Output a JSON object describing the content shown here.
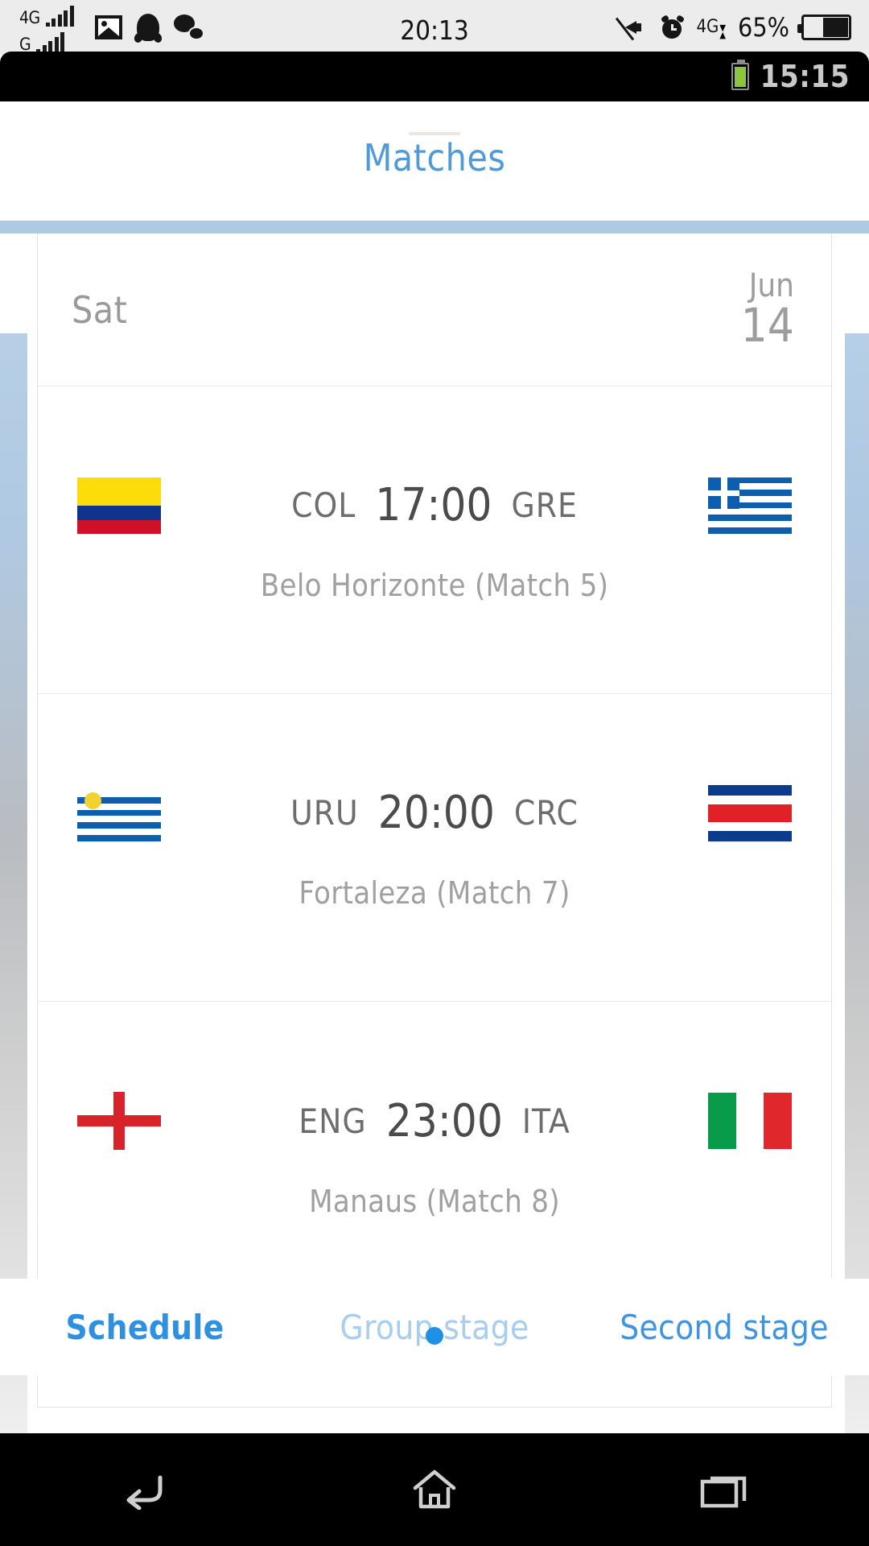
{
  "system_status_bar": {
    "sim1": {
      "network": "4G",
      "signal_bars": 5
    },
    "sim2": {
      "network": "G",
      "signal_bars": 5
    },
    "notification_icons": [
      "photo-icon",
      "qq-icon",
      "wechat-icon"
    ],
    "clock": "20:13",
    "right_icons": [
      "mute-icon",
      "alarm-icon",
      "mobile-data-4g-icon"
    ],
    "battery_percent": "65%",
    "data_network": "4G"
  },
  "inner_status_bar": {
    "battery": "battery-icon",
    "battery_color": "#8cc63f",
    "clock": "15:15"
  },
  "header": {
    "title": "Matches"
  },
  "schedule": {
    "date": {
      "weekday": "Sat",
      "month": "Jun",
      "day": "14"
    },
    "matches": [
      {
        "home_code": "COL",
        "home_flag": "colombia-flag",
        "kickoff": "17:00",
        "away_code": "GRE",
        "away_flag": "greece-flag",
        "venue": "Belo Horizonte (Match  5)"
      },
      {
        "home_code": "URU",
        "home_flag": "uruguay-flag",
        "kickoff": "20:00",
        "away_code": "CRC",
        "away_flag": "costa-rica-flag",
        "venue": "Fortaleza (Match  7)"
      },
      {
        "home_code": "ENG",
        "home_flag": "england-flag",
        "kickoff": "23:00",
        "away_code": "ITA",
        "away_flag": "italy-flag",
        "venue": "Manaus (Match  8)"
      }
    ]
  },
  "tabs": [
    {
      "label": "Schedule",
      "state": "active"
    },
    {
      "label": "Group stage",
      "state": "dim"
    },
    {
      "label": "Second stage",
      "state": "normal"
    }
  ],
  "colors": {
    "accent_blue": "#4f9ad9",
    "tab_active": "#2f8fe0",
    "tab_dim": "#a8cdee",
    "page_indicator": "#1e90e8",
    "rail_blue": "#aec9e4"
  },
  "navigation_bar": {
    "buttons": [
      "back-icon",
      "home-icon",
      "recent-apps-icon"
    ]
  }
}
